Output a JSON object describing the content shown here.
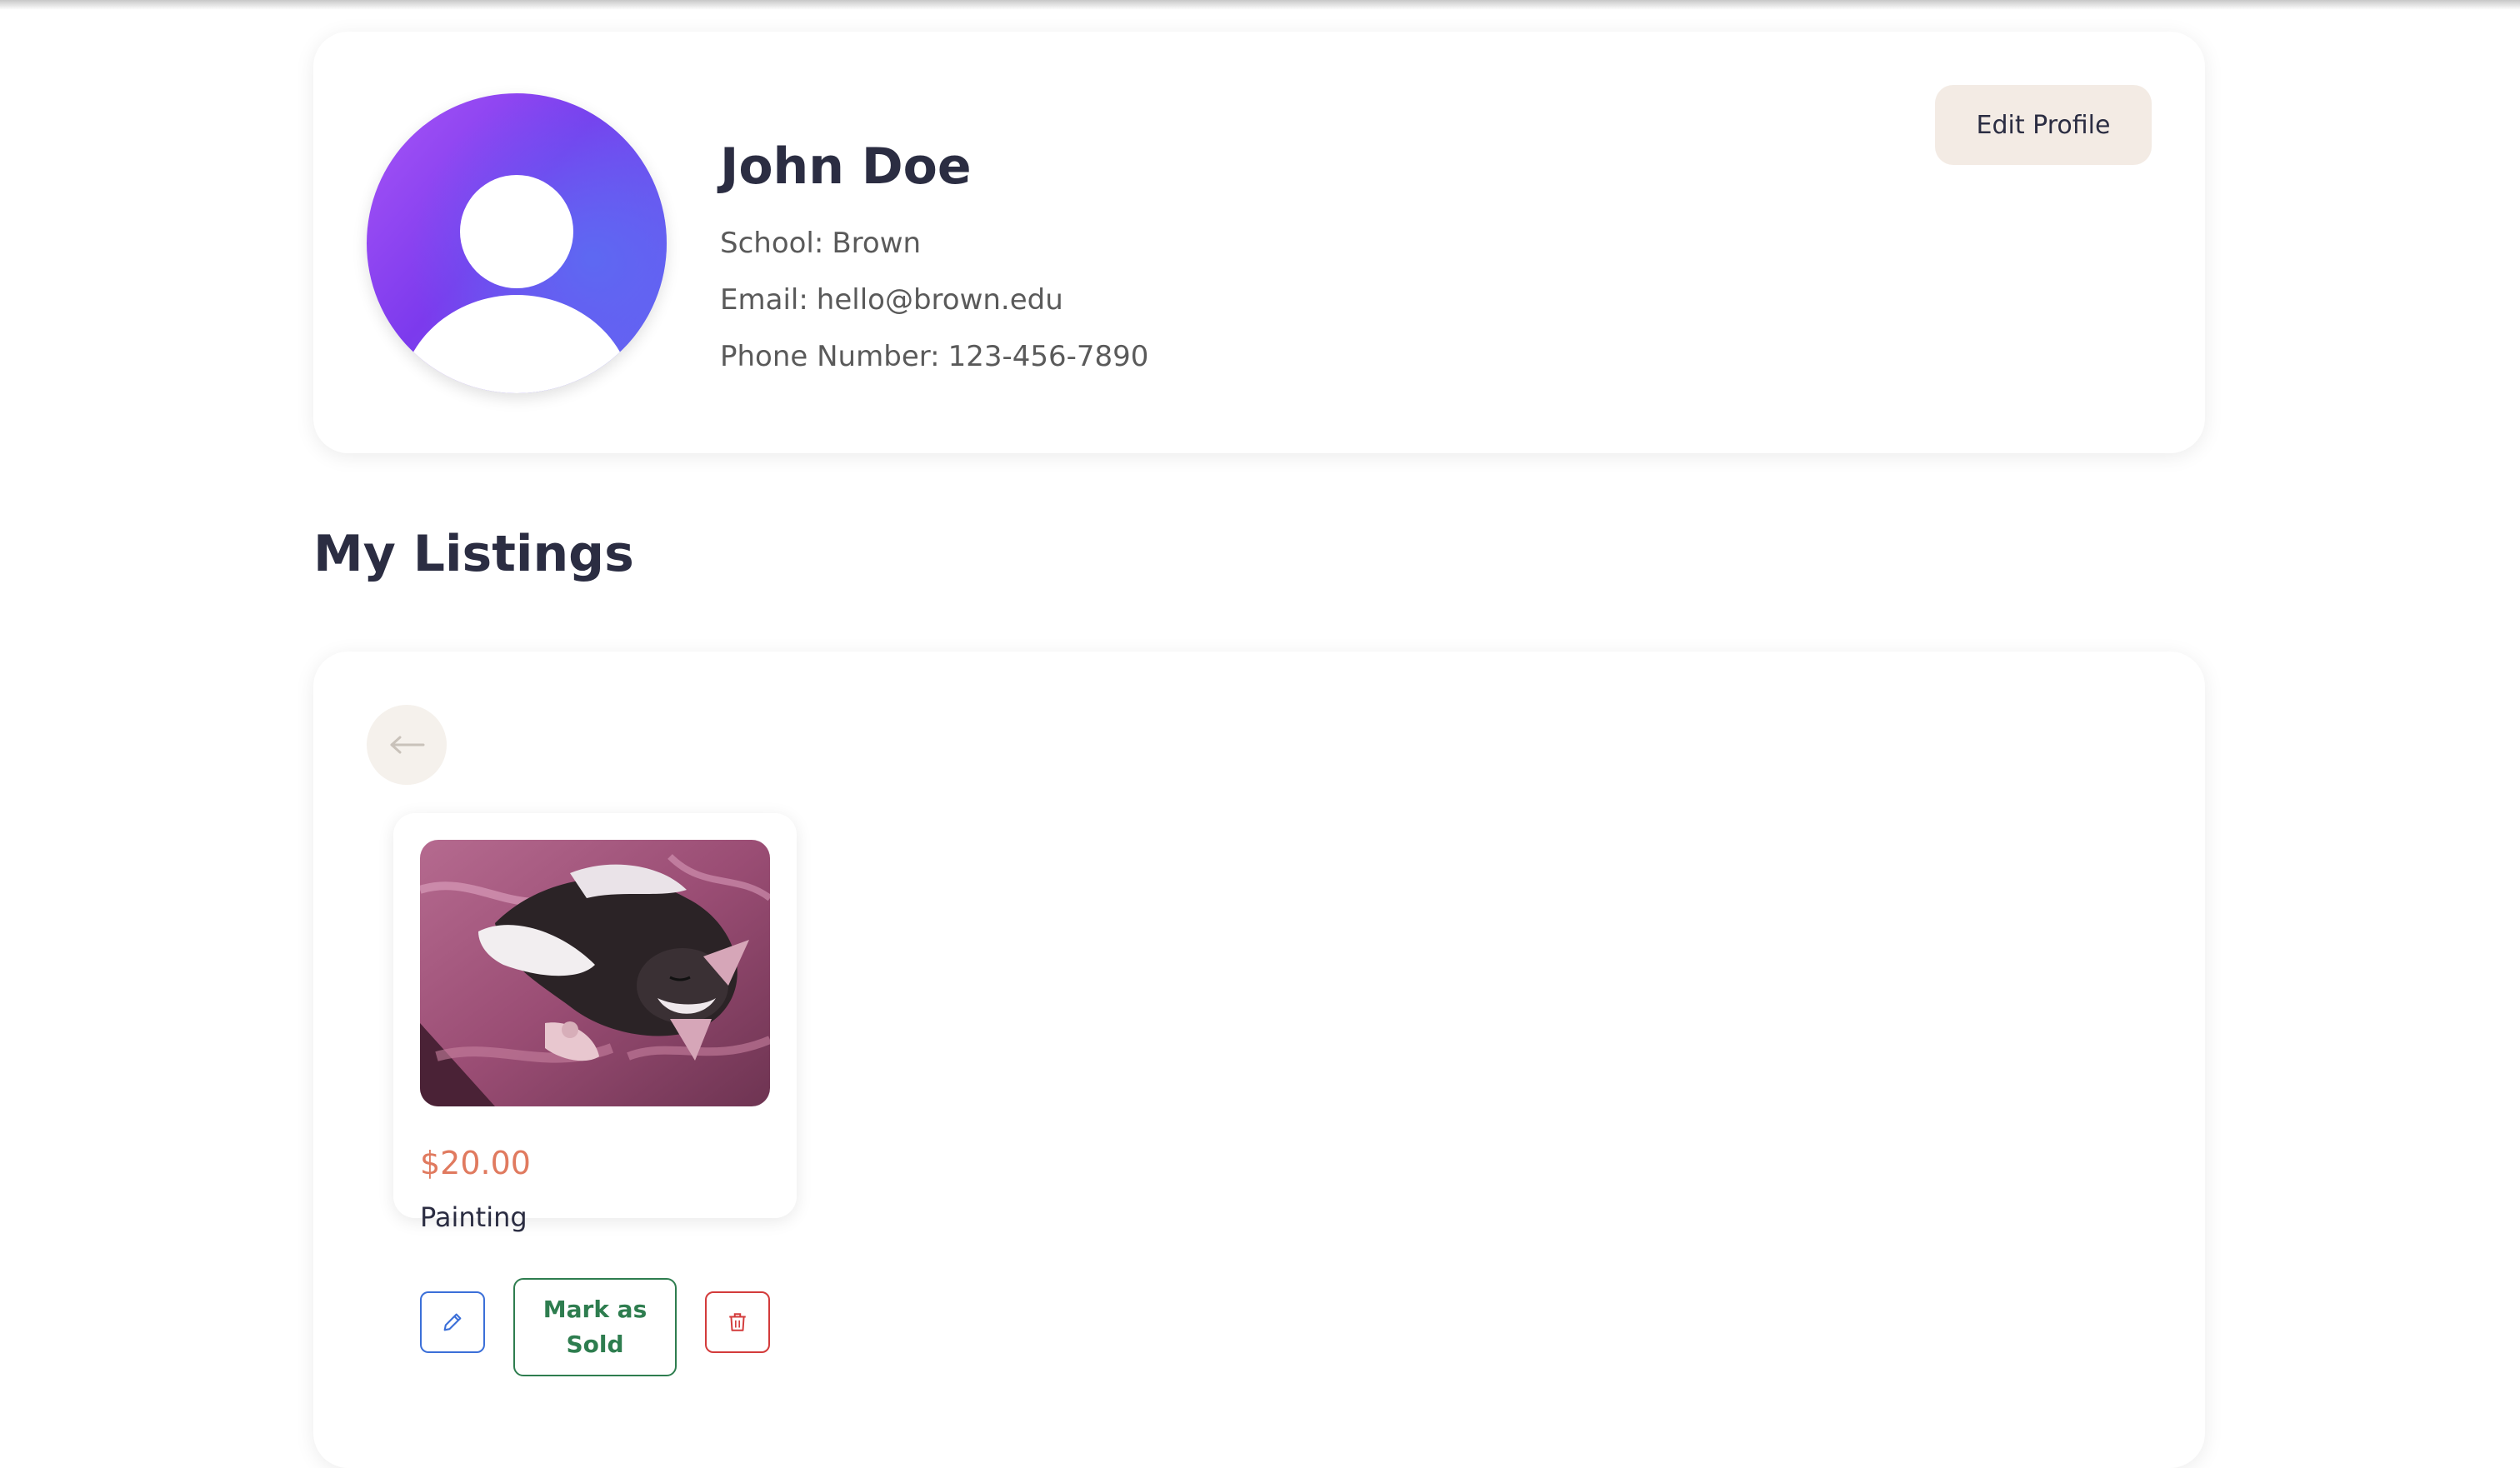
{
  "profile": {
    "name": "John Doe",
    "school_label": "School:",
    "school": "Brown",
    "email_label": "Email:",
    "email": "hello@brown.edu",
    "phone_label": "Phone Number:",
    "phone": "123-456-7890",
    "edit_button": "Edit Profile"
  },
  "listings": {
    "heading": "My Listings",
    "back_icon": "arrow-left-icon",
    "items": [
      {
        "price": "$20.00",
        "title": "Painting",
        "image_subject": "painting of a cat lying on a pink blanket",
        "mark_sold_label_line1": "Mark as",
        "mark_sold_label_line2": "Sold",
        "edit_icon": "pencil-icon",
        "delete_icon": "trash-icon"
      }
    ]
  },
  "colors": {
    "price": "#e07a5f",
    "edit_outline": "#3b6fd8",
    "sold_outline": "#2e7d4f",
    "delete_outline": "#d33b3b",
    "edit_profile_bg": "#f3ebe4"
  }
}
